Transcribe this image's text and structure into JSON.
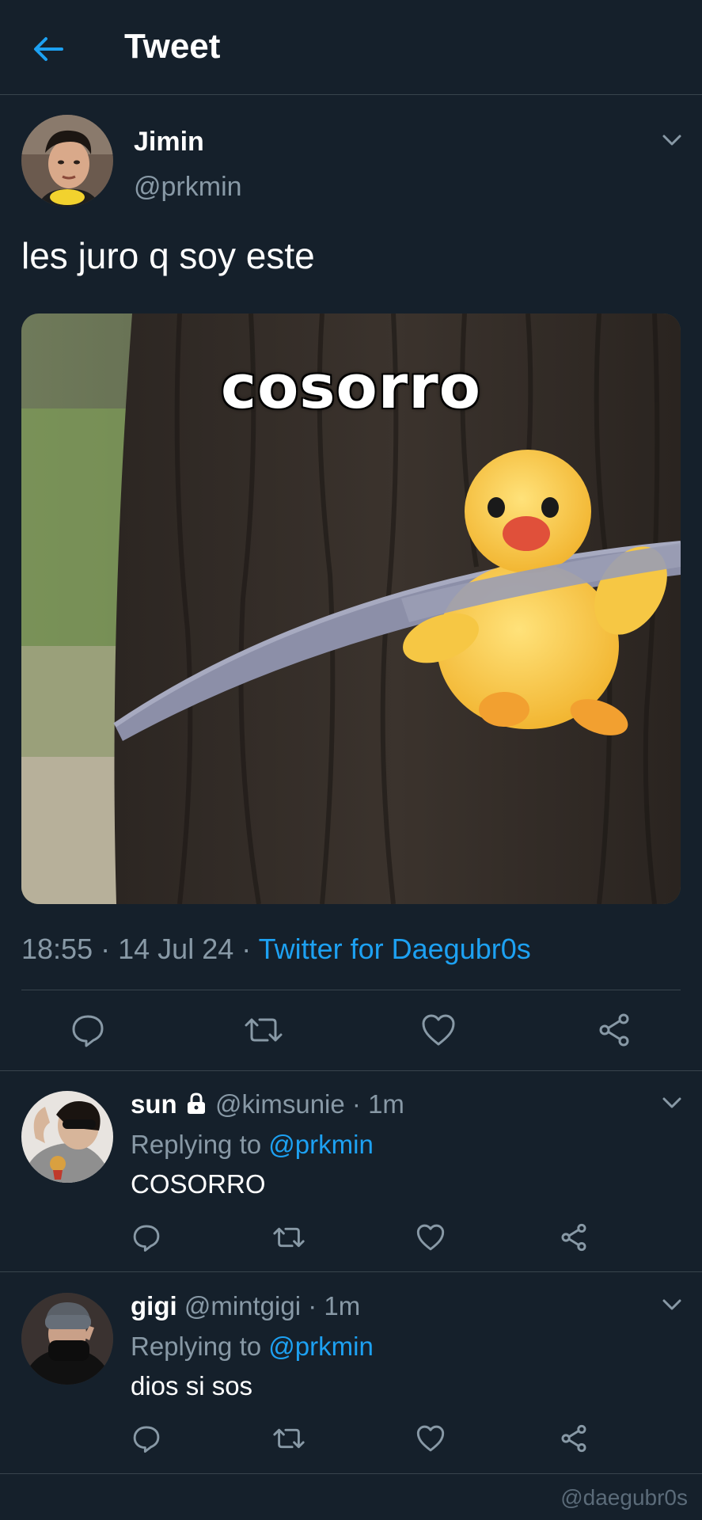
{
  "header": {
    "title": "Tweet"
  },
  "tweet": {
    "author_name": "Jimin",
    "author_handle": "@prkmin",
    "text": "les juro q soy este",
    "media_caption": "cosorro",
    "time": "18:55",
    "date": "14 Jul 24",
    "separator": "·",
    "source": "Twitter for Daegubr0s"
  },
  "replies": [
    {
      "name": "sun",
      "locked": true,
      "handle": "@kimsunie",
      "time": "1m",
      "replying_label": "Replying to",
      "replying_to": "@prkmin",
      "text": "COSORRO"
    },
    {
      "name": "gigi",
      "locked": false,
      "handle": "@mintgigi",
      "time": "1m",
      "replying_label": "Replying to",
      "replying_to": "@prkmin",
      "text": "dios si sos"
    }
  ],
  "watermark": "@daegubr0s",
  "colors": {
    "background": "#15202b",
    "accent": "#1da1f2",
    "muted": "#8899a6",
    "divider": "#38444d"
  },
  "icons": [
    "back-arrow-icon",
    "chevron-down-icon",
    "reply-icon",
    "retweet-icon",
    "like-icon",
    "share-icon",
    "lock-icon"
  ]
}
